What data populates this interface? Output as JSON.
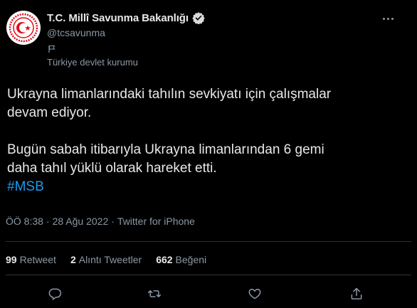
{
  "author": {
    "display_name": "T.C. Millî Savunma Bakanlığı",
    "handle": "@tcsavunma",
    "label": "Türkiye devlet kurumu",
    "avatar_icon": "ministry-emblem",
    "verified_icon": "verified-badge-icon"
  },
  "tweet": {
    "line1": "Ukrayna limanlarındaki tahılın sevkiyatı için çalışmalar",
    "line2": "devam ediyor.",
    "line3": "Bugün sabah itibarıyla Ukrayna limanlarından 6 gemi",
    "line4": "daha tahıl yüklü olarak hareket etti.",
    "hashtag": "#MSB"
  },
  "meta": {
    "time": "ÖÖ 8:38",
    "date": "28 Ağu 2022",
    "source": "Twitter for iPhone"
  },
  "stats": {
    "retweets_count": "99",
    "retweets_label": "Retweet",
    "quotes_count": "2",
    "quotes_label": "Alıntı Tweetler",
    "likes_count": "662",
    "likes_label": "Beğeni"
  },
  "colors": {
    "background": "#000000",
    "text": "#e7e9ea",
    "secondary": "#8b98a5",
    "accent": "#1d9bf0",
    "avatar_red": "#e30a17"
  }
}
